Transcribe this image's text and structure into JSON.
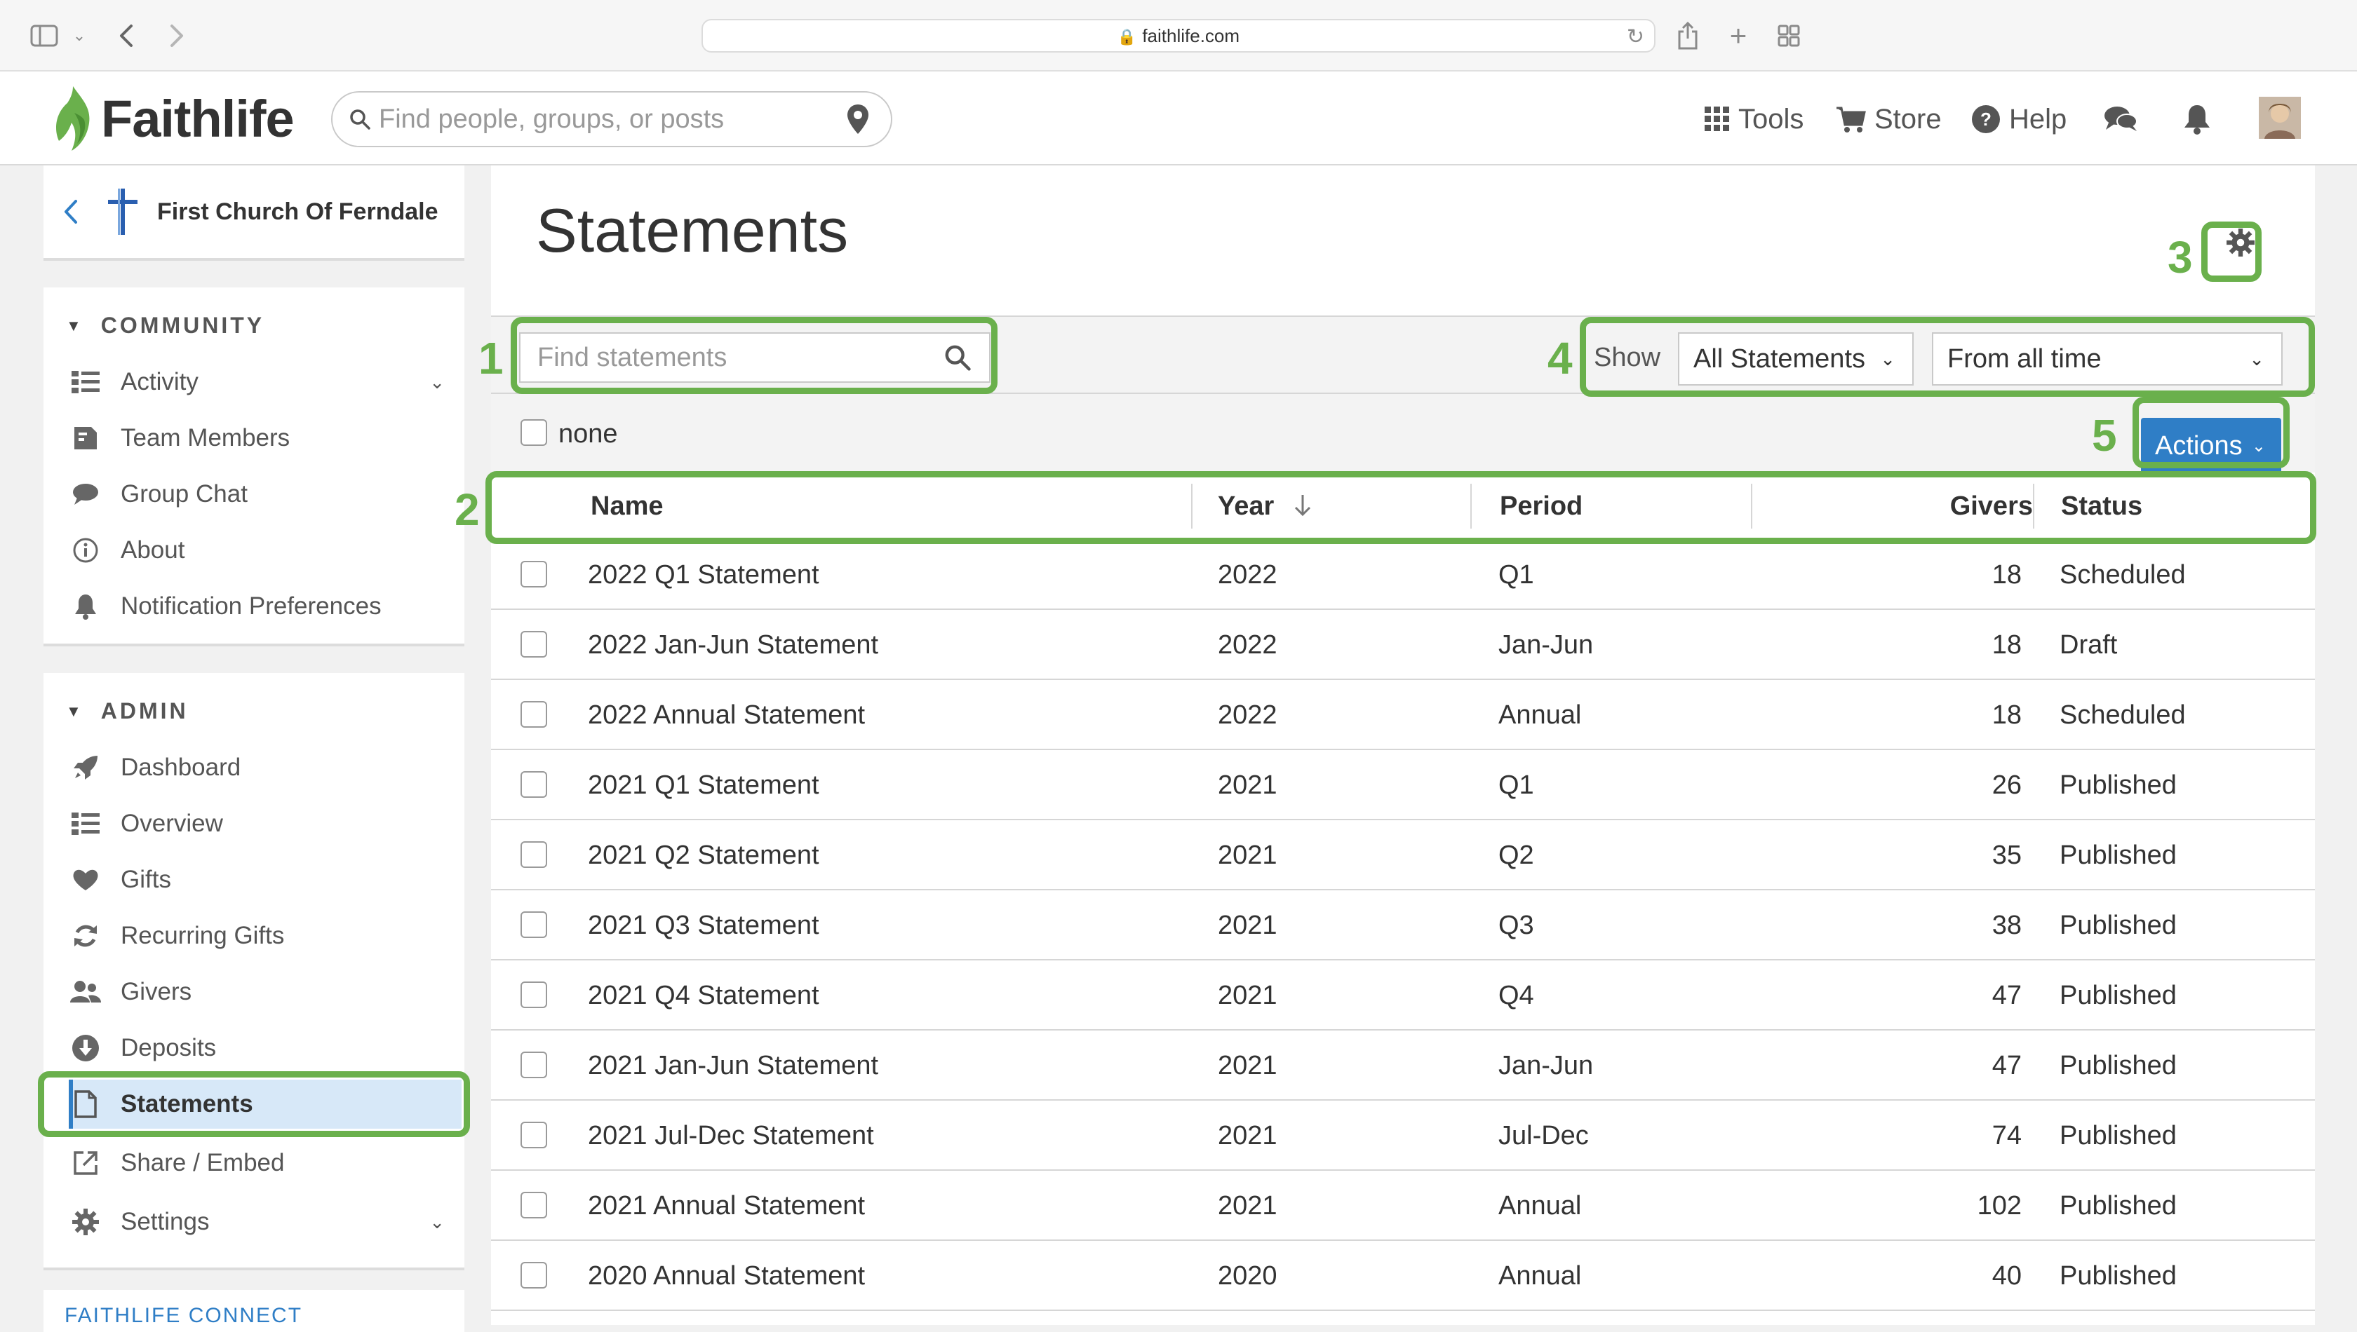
{
  "browser": {
    "url": "faithlife.com"
  },
  "header": {
    "logo_text": "Faithlife",
    "search_placeholder": "Find people, groups, or posts",
    "tools_label": "Tools",
    "store_label": "Store",
    "help_label": "Help"
  },
  "sidebar": {
    "church_name": "First Church Of Ferndale",
    "community_heading": "COMMUNITY",
    "community_items": [
      {
        "label": "Activity",
        "icon": "list-icon"
      },
      {
        "label": "Team Members",
        "icon": "id-card-icon"
      },
      {
        "label": "Group Chat",
        "icon": "chat-icon"
      },
      {
        "label": "About",
        "icon": "info-icon"
      },
      {
        "label": "Notification Preferences",
        "icon": "bell-icon"
      }
    ],
    "admin_heading": "ADMIN",
    "admin_items": [
      {
        "label": "Dashboard",
        "icon": "rocket-icon"
      },
      {
        "label": "Overview",
        "icon": "list-icon"
      },
      {
        "label": "Gifts",
        "icon": "heart-icon"
      },
      {
        "label": "Recurring Gifts",
        "icon": "refresh-icon"
      },
      {
        "label": "Givers",
        "icon": "users-icon"
      },
      {
        "label": "Deposits",
        "icon": "download-icon"
      },
      {
        "label": "Statements",
        "icon": "document-icon"
      },
      {
        "label": "Share / Embed",
        "icon": "external-link-icon"
      },
      {
        "label": "Settings",
        "icon": "gear-icon"
      }
    ],
    "connect_heading": "FAITHLIFE CONNECT"
  },
  "main": {
    "title": "Statements",
    "find_placeholder": "Find statements",
    "show_label": "Show",
    "filter_status": "All Statements",
    "filter_time": "From all time",
    "select_none_label": "none",
    "actions_label": "Actions",
    "columns": {
      "name": "Name",
      "year": "Year",
      "period": "Period",
      "givers": "Givers",
      "status": "Status"
    },
    "rows": [
      {
        "name": "2022 Q1 Statement",
        "year": "2022",
        "period": "Q1",
        "givers": "18",
        "status": "Scheduled"
      },
      {
        "name": "2022 Jan-Jun Statement",
        "year": "2022",
        "period": "Jan-Jun",
        "givers": "18",
        "status": "Draft"
      },
      {
        "name": "2022 Annual Statement",
        "year": "2022",
        "period": "Annual",
        "givers": "18",
        "status": "Scheduled"
      },
      {
        "name": "2021 Q1 Statement",
        "year": "2021",
        "period": "Q1",
        "givers": "26",
        "status": "Published"
      },
      {
        "name": "2021 Q2 Statement",
        "year": "2021",
        "period": "Q2",
        "givers": "35",
        "status": "Published"
      },
      {
        "name": "2021 Q3 Statement",
        "year": "2021",
        "period": "Q3",
        "givers": "38",
        "status": "Published"
      },
      {
        "name": "2021 Q4 Statement",
        "year": "2021",
        "period": "Q4",
        "givers": "47",
        "status": "Published"
      },
      {
        "name": "2021 Jan-Jun Statement",
        "year": "2021",
        "period": "Jan-Jun",
        "givers": "47",
        "status": "Published"
      },
      {
        "name": "2021 Jul-Dec Statement",
        "year": "2021",
        "period": "Jul-Dec",
        "givers": "74",
        "status": "Published"
      },
      {
        "name": "2021 Annual Statement",
        "year": "2021",
        "period": "Annual",
        "givers": "102",
        "status": "Published"
      },
      {
        "name": "2020 Annual Statement",
        "year": "2020",
        "period": "Annual",
        "givers": "40",
        "status": "Published"
      }
    ]
  },
  "callouts": [
    "1",
    "2",
    "3",
    "4",
    "5"
  ],
  "colors": {
    "accent": "#2f7ec6",
    "callout": "#6ab04c",
    "active_bg": "#d7e8f8"
  }
}
